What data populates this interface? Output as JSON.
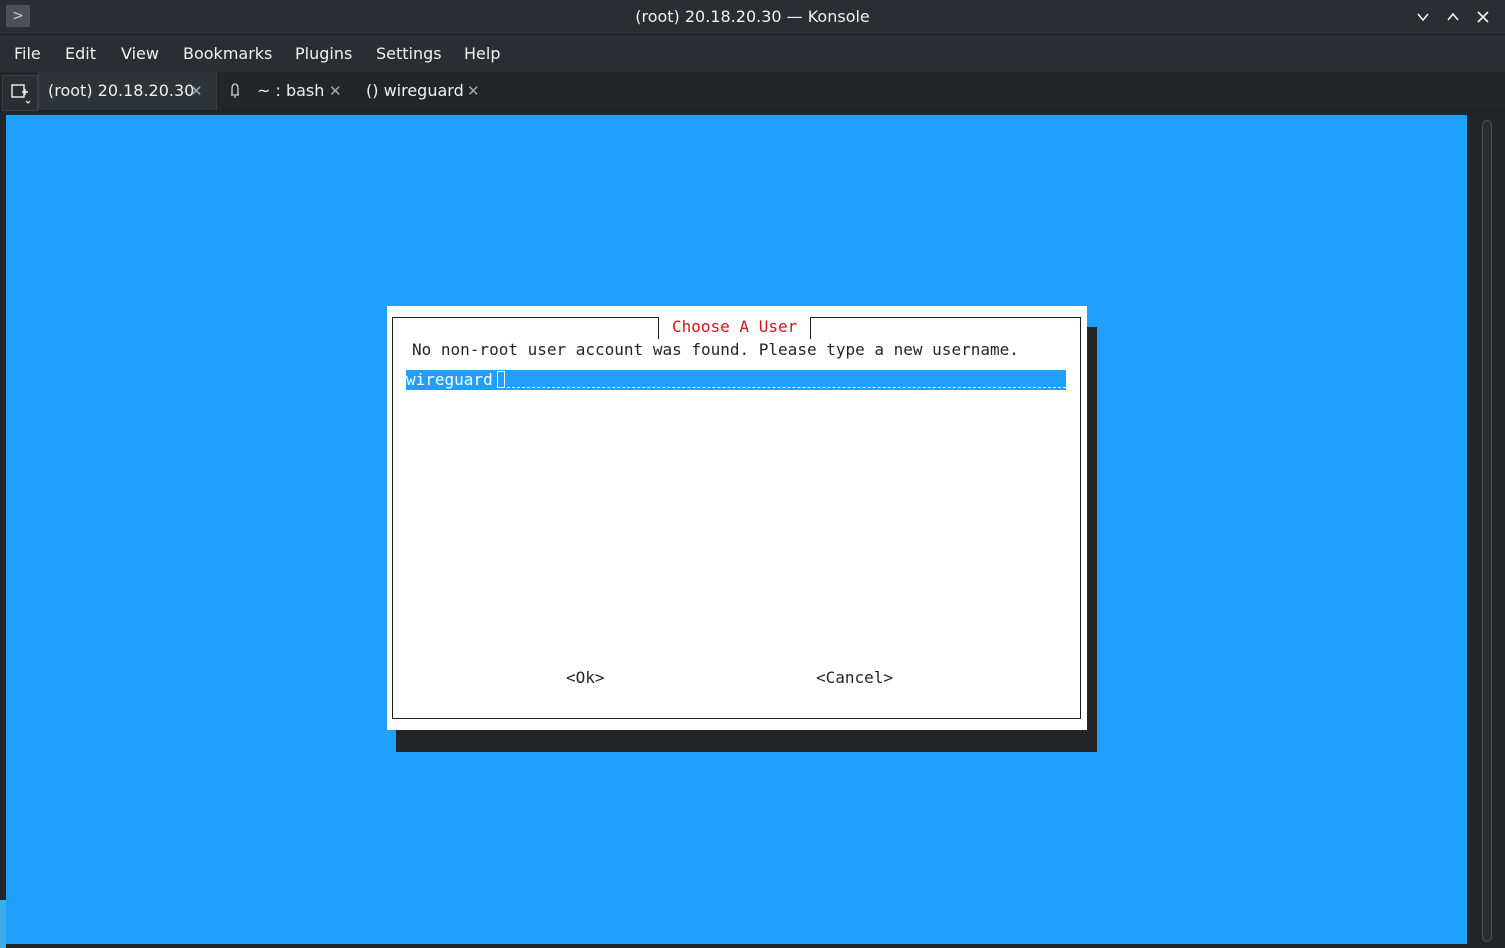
{
  "window": {
    "title": "(root) 20.18.20.30 — Konsole",
    "app_icon": ">"
  },
  "menu": {
    "items": [
      "File",
      "Edit",
      "View",
      "Bookmarks",
      "Plugins",
      "Settings",
      "Help"
    ]
  },
  "tabs": [
    {
      "label": "(root) 20.18.20.30",
      "active": true
    },
    {
      "label": "~ : bash",
      "active": false,
      "icon": "bell-icon"
    },
    {
      "label": "() wireguard",
      "active": false
    }
  ],
  "dialog": {
    "title": "Choose A User",
    "message": "No non-root user account was found. Please type a new username.",
    "input_value": "wireguard",
    "ok_label": "<Ok>",
    "cancel_label": "<Cancel>"
  },
  "colors": {
    "terminal_bg": "#1fa0ff",
    "dialog_title": "#d0151b",
    "chrome": "#2a2e32"
  }
}
